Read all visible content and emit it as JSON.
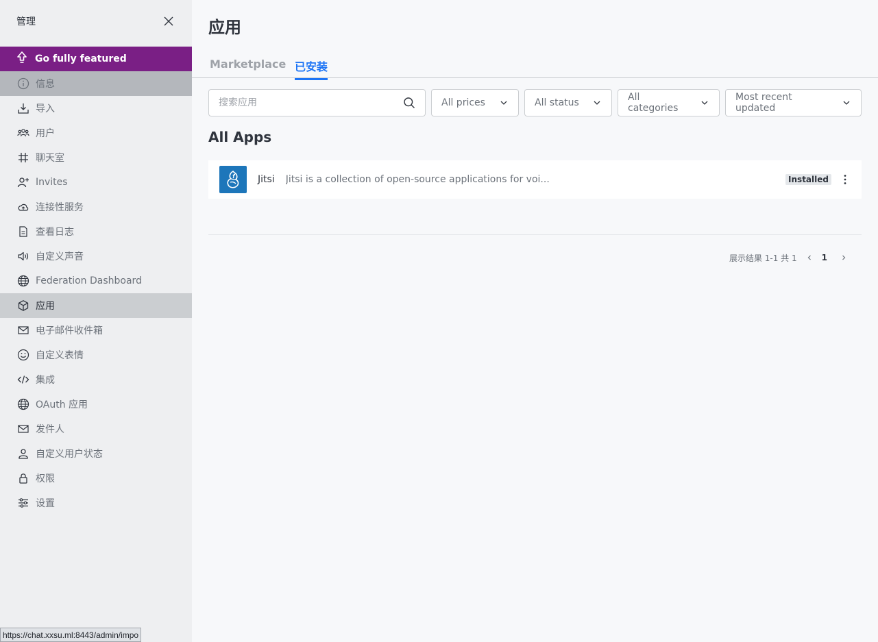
{
  "sidebar": {
    "title": "管理",
    "upgrade_label": "Go fully featured",
    "items": [
      {
        "label": "信息",
        "icon": "info-icon"
      },
      {
        "label": "导入",
        "icon": "import-icon"
      },
      {
        "label": "用户",
        "icon": "users-icon"
      },
      {
        "label": "聊天室",
        "icon": "hashtag-icon"
      },
      {
        "label": "Invites",
        "icon": "user-plus-icon"
      },
      {
        "label": "连接性服务",
        "icon": "cloud-icon"
      },
      {
        "label": "查看日志",
        "icon": "file-icon"
      },
      {
        "label": "自定义声音",
        "icon": "volume-icon"
      },
      {
        "label": "Federation Dashboard",
        "icon": "globe-icon"
      },
      {
        "label": "应用",
        "icon": "cube-icon"
      },
      {
        "label": "电子邮件收件箱",
        "icon": "mail-icon"
      },
      {
        "label": "自定义表情",
        "icon": "emoji-icon"
      },
      {
        "label": "集成",
        "icon": "code-icon"
      },
      {
        "label": "OAuth 应用",
        "icon": "globe-icon"
      },
      {
        "label": "发件人",
        "icon": "mail-icon"
      },
      {
        "label": "自定义用户状态",
        "icon": "user-icon"
      },
      {
        "label": "权限",
        "icon": "lock-icon"
      },
      {
        "label": "设置",
        "icon": "sliders-icon"
      }
    ]
  },
  "status_url": "https://chat.xxsu.ml:8443/admin/impo",
  "main": {
    "title": "应用",
    "tabs": [
      {
        "label": "Marketplace"
      },
      {
        "label": "已安装"
      }
    ],
    "search": {
      "placeholder": "搜索应用",
      "value": ""
    },
    "filters": {
      "prices": "All prices",
      "status": "All status",
      "categories": "All categories",
      "sort": "Most recent updated"
    },
    "section_title": "All Apps",
    "apps": [
      {
        "name": "Jitsi",
        "description": "Jitsi is a collection of open-source applications for voi...",
        "badge": "Installed"
      }
    ],
    "pagination": {
      "summary": "展示结果 1-1 共 1",
      "current_page": "1"
    }
  },
  "colors": {
    "accent": "#1d74f5",
    "upgrade_bg": "#7a1f85",
    "app_logo_bg": "#1d76ba"
  }
}
